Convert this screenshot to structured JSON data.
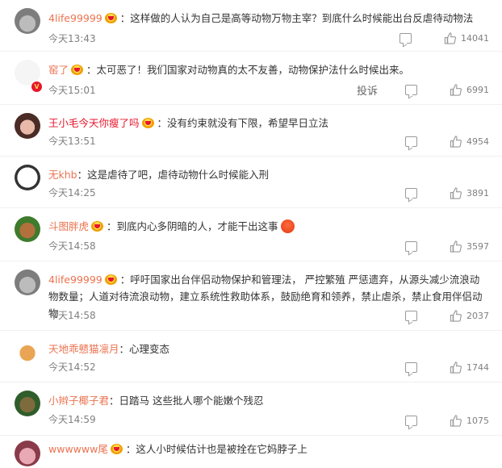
{
  "comments": [
    {
      "username": "4life99999",
      "text": "：这样做的人认为自己是高等动物万物主宰？到底什么时候能出台反虐待动物法",
      "time": "今天13:43",
      "likes": "14041",
      "avatar": "cat-avatar"
    },
    {
      "username": "窑了",
      "text": "：太可恶了！我们国家对动物真的太不友善，动物保护法什么时候出来。",
      "time": "今天15:01",
      "likes": "6991",
      "report": "投诉",
      "avatar": "sketch-avatar",
      "verified": "V"
    },
    {
      "username": "王小毛今天你瘦了吗",
      "text": "：没有约束就没有下限，希望早日立法",
      "time": "今天13:51",
      "likes": "4954",
      "avatar": "girl-avatar"
    },
    {
      "username": "无khb",
      "text": "：这是虐待了吧，虐待动物什么时候能入刑",
      "time": "今天14:25",
      "likes": "3891",
      "avatar": "panda-meme-avatar"
    },
    {
      "username": "斗图胖虎",
      "text": "：到底内心多阴暗的人，才能干出这事",
      "time": "今天14:58",
      "likes": "3597",
      "avatar": "man-avatar"
    },
    {
      "username": "4life99999",
      "text": "：呼吁国家出台伴侣动物保护和管理法， 严控繁殖 严惩遗弃，从源头减少流浪动物数量；人道对待流浪动物，建立系统性救助体系，鼓励绝育和领养，禁止虐杀，禁止食用伴侣动物",
      "time": "今天14:58",
      "likes": "2037",
      "avatar": "cat-avatar"
    },
    {
      "username": "天地乖戆猫凛月",
      "text": "：心理变态",
      "time": "今天14:52",
      "likes": "1744",
      "avatar": "shiba-avatar"
    },
    {
      "username": "小辫子椰子君",
      "text": "：日踏马 这些批人哪个能嫩个残忍",
      "time": "今天14:59",
      "likes": "1075",
      "avatar": "horse-avatar"
    },
    {
      "username": "wwwwww尾",
      "text": "：这人小时候估计也是被拴在它妈脖子上",
      "time": "",
      "likes": "",
      "avatar": "pink-avatar"
    }
  ],
  "colors": {
    "username_orange": "#eb7350",
    "username_red": "#e6162d",
    "meta_gray": "#808080"
  },
  "icons": {
    "comment": "comment-bubble-icon",
    "like": "thumbs-up-icon",
    "vip": "vip-crown-icon"
  }
}
